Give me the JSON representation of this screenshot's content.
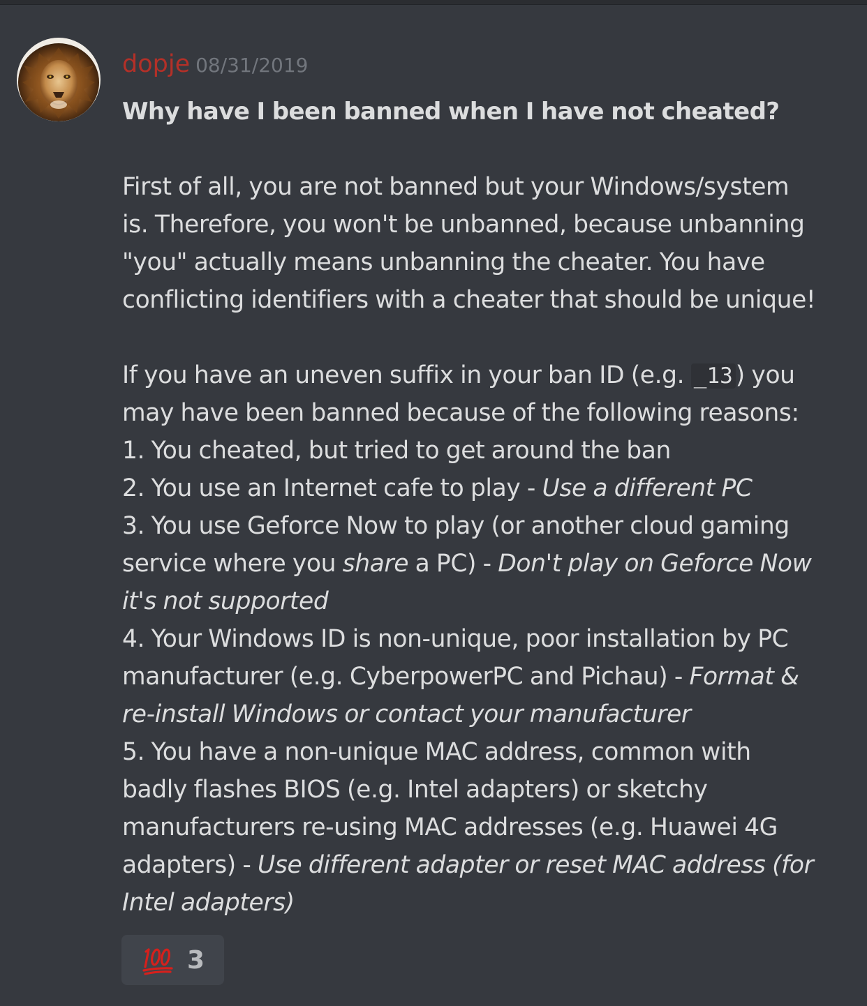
{
  "message": {
    "author": "dopje",
    "timestamp": "08/31/2019",
    "avatar_icon": "lion-avatar-icon",
    "colors": {
      "background": "#36393f",
      "username": "#b33028",
      "text": "#dcddde",
      "timestamp": "#72767d"
    },
    "title": "Why have I been banned when I have not cheated?",
    "paragraph1": {
      "lines": [
        "First of all, you are not banned but your Windows/system",
        "is. Therefore, you won't be unbanned, because unbanning",
        "\"you\" actually means unbanning the cheater. You have",
        "conflicting identifiers with a cheater that should be unique!"
      ]
    },
    "paragraph2": {
      "line1_before_code": "If you have an uneven suffix in your ban ID (e.g. ",
      "line1_code": "_13",
      "line1_after_code": ") you",
      "line2": "may have been banned because of the following reasons:"
    },
    "reasons": {
      "r1": "1. You cheated, but tried to get around the ban",
      "r2_plain": "2. You use an Internet cafe to play - ",
      "r2_italic": "Use a different PC",
      "r3_line1": "3. You use Geforce Now to play (or another cloud gaming",
      "r3_line2_plain1": "service where you ",
      "r3_line2_italic1": "share",
      "r3_line2_plain2": " a PC) - ",
      "r3_line2_italic2": "Don't play on Geforce Now",
      "r3_line3_italic": "it's not supported",
      "r4_line1": "4. Your Windows ID is non-unique, poor installation by PC",
      "r4_line2_plain": "manufacturer (e.g. CyberpowerPC and Pichau) - ",
      "r4_line2_italic": "Format &",
      "r4_line3_italic": "re-install Windows or contact your manufacturer",
      "r5_line1": "5. You have a non-unique MAC address, common with",
      "r5_line2": "badly flashes BIOS (e.g. Intel adapters) or sketchy",
      "r5_line3": "manufacturers re-using MAC addresses (e.g. Huawei 4G",
      "r5_line4_plain": "adapters) - ",
      "r5_line4_italic": "Use different adapter or reset MAC address (for",
      "r5_line5_italic": "Intel adapters)"
    },
    "reaction": {
      "emoji_icon": "hundred-points-icon",
      "count": "3"
    }
  }
}
